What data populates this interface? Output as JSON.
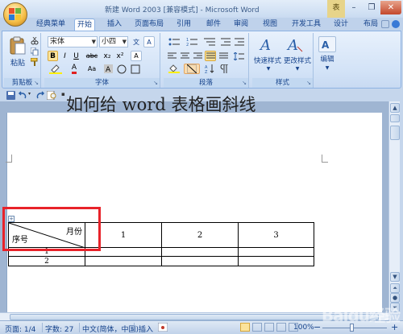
{
  "window": {
    "title_doc": "新建 Word 2003 [兼容模式]",
    "title_sep": " - ",
    "title_app": "Microsoft Word",
    "context_tab": "表",
    "minimize": "–",
    "maximize": "❐",
    "close": "✕"
  },
  "tabs": [
    {
      "label": "经典菜单"
    },
    {
      "label": "开始"
    },
    {
      "label": "插入"
    },
    {
      "label": "页面布局"
    },
    {
      "label": "引用"
    },
    {
      "label": "邮件"
    },
    {
      "label": "审阅"
    },
    {
      "label": "视图"
    },
    {
      "label": "开发工具"
    },
    {
      "label": "设计"
    },
    {
      "label": "布局"
    }
  ],
  "ribbon": {
    "clipboard": {
      "label": "剪贴板",
      "paste": "粘贴"
    },
    "font": {
      "label": "字体",
      "font_name": "宋体",
      "font_size": "小四",
      "bold": "B",
      "italic": "I",
      "underline": "U",
      "strike": "abc",
      "sub": "x₂",
      "sup": "x²",
      "color_a": "A",
      "aa": "Aa",
      "clear": "A",
      "wen": "文",
      "char_border": "A"
    },
    "paragraph": {
      "label": "段落"
    },
    "styles": {
      "label": "样式",
      "quick": "快速样式",
      "change": "更改样式"
    },
    "editing": {
      "label": "编辑"
    }
  },
  "document": {
    "heading": "如何给 word 表格画斜线",
    "table": {
      "diag_top": "月份",
      "diag_bottom": "序号",
      "header_cols": [
        "1",
        "2",
        "3"
      ],
      "rows": [
        {
          "label": "1",
          "cells": [
            "",
            "",
            ""
          ]
        },
        {
          "label": "2",
          "cells": [
            "",
            "",
            ""
          ]
        }
      ]
    }
  },
  "status": {
    "page": "页面: 1/4",
    "words": "字数: 27",
    "lang": "中文(简体，中国)",
    "mode": "插入",
    "zoom": "100%",
    "zoom_level_percent": 100,
    "zoom_minus": "−",
    "zoom_plus": "+"
  },
  "watermark": "Baidu经验",
  "colors": {
    "accent": "#e8232a",
    "ribbon": "#d3e3f7",
    "tab_text": "#15428b"
  }
}
